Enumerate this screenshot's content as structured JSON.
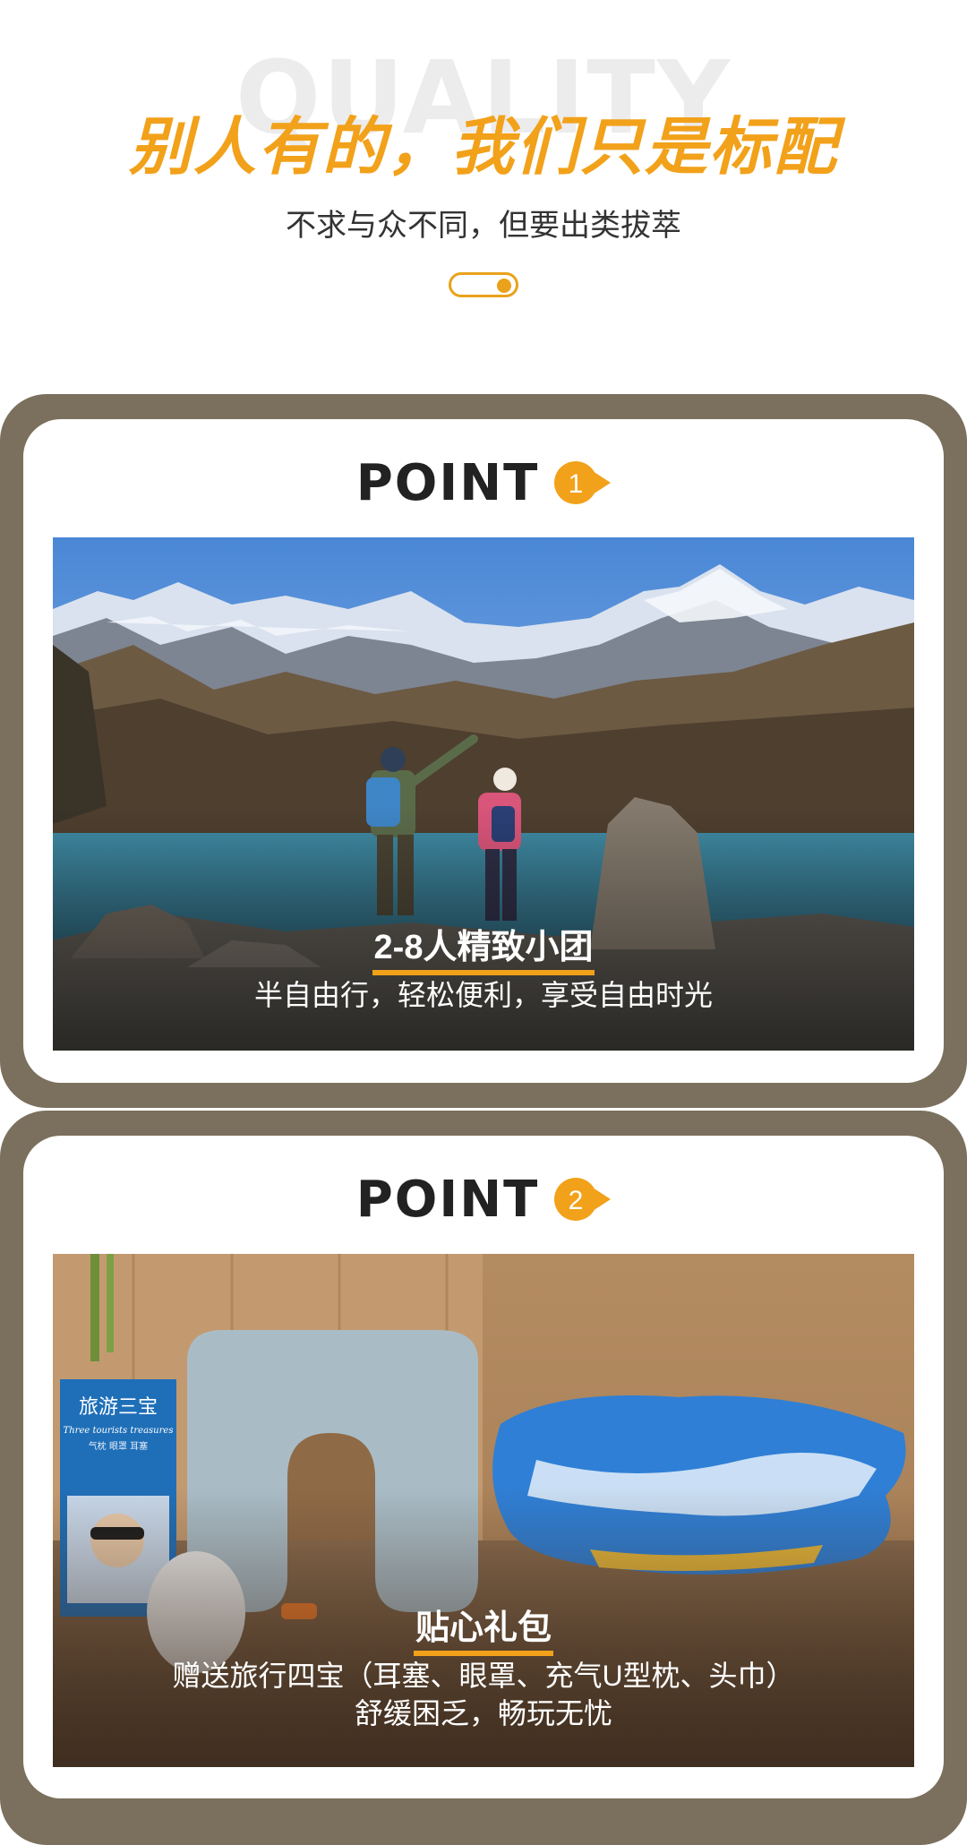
{
  "header": {
    "bg_word": "QUALITY",
    "title": "别人有的，我们只是标配",
    "subtitle": "不求与众不同，但要出类拔萃"
  },
  "colors": {
    "accent": "#f2a11a",
    "frame": "#7b705d"
  },
  "points": [
    {
      "label": "POINT",
      "number": "1",
      "caption_title": "2-8人精致小团",
      "caption_lines": [
        "半自由行，轻松便利，享受自由时光"
      ]
    },
    {
      "label": "POINT",
      "number": "2",
      "caption_title": "贴心礼包",
      "caption_lines": [
        "赠送旅行四宝（耳塞、眼罩、充气U型枕、头巾）",
        "舒缓困乏，畅玩无忧"
      ],
      "package_text": {
        "title": "旅游三宝",
        "subtitle": "Three tourists treasures",
        "items": "气枕 眼罩 耳塞"
      }
    }
  ]
}
